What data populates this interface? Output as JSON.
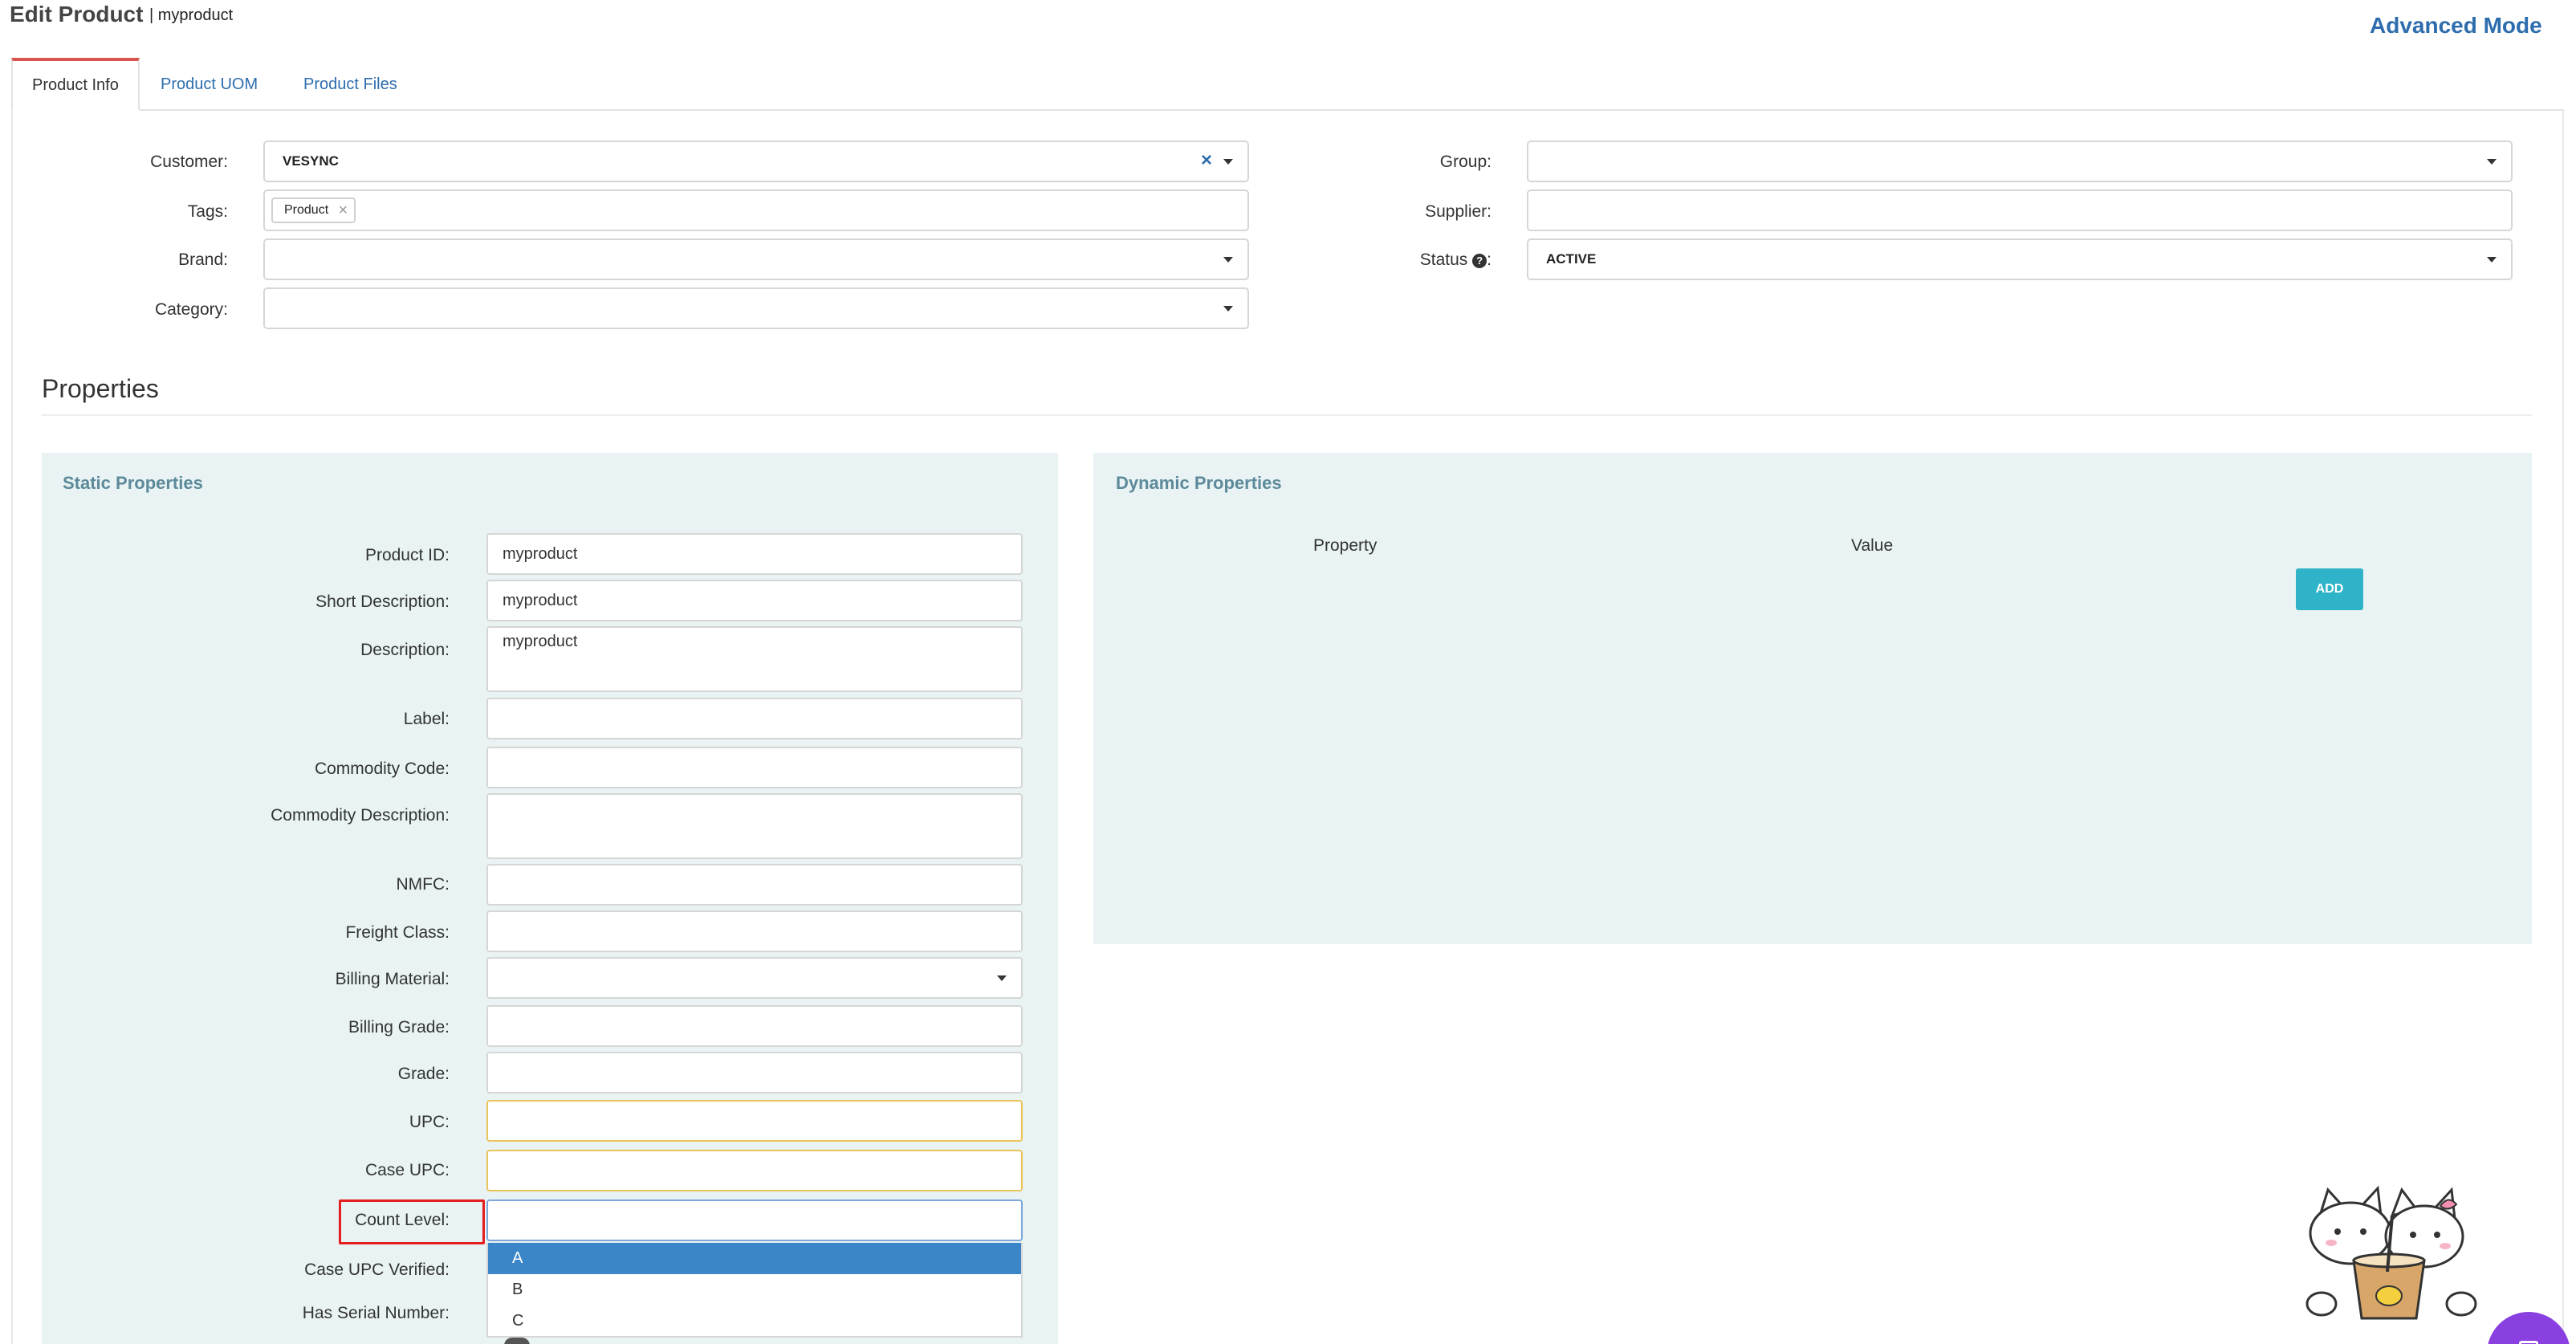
{
  "header": {
    "title": "Edit Product",
    "subtitle": "| myproduct",
    "advanced_mode": "Advanced Mode"
  },
  "tabs": [
    {
      "label": "Product Info",
      "active": true
    },
    {
      "label": "Product UOM",
      "active": false
    },
    {
      "label": "Product Files",
      "active": false
    }
  ],
  "top_form": {
    "customer": {
      "label": "Customer:",
      "value": "VESYNC"
    },
    "tags": {
      "label": "Tags:",
      "items": [
        "Product"
      ]
    },
    "brand": {
      "label": "Brand:",
      "value": ""
    },
    "category": {
      "label": "Category:",
      "value": ""
    },
    "group": {
      "label": "Group:",
      "value": ""
    },
    "supplier": {
      "label": "Supplier:",
      "value": ""
    },
    "status": {
      "label": "Status",
      "suffix": ":",
      "value": "ACTIVE"
    }
  },
  "properties": {
    "title": "Properties",
    "static_title": "Static Properties",
    "dynamic_title": "Dynamic Properties",
    "dynamic_columns": [
      "Property",
      "Value"
    ],
    "add_label": "ADD"
  },
  "static_fields": [
    {
      "label": "Product ID:",
      "value": "myproduct"
    },
    {
      "label": "Short Description:",
      "value": "myproduct"
    },
    {
      "label": "Description:",
      "value": "myproduct"
    },
    {
      "label": "Label:",
      "value": ""
    },
    {
      "label": "Commodity Code:",
      "value": ""
    },
    {
      "label": "Commodity Description:",
      "value": ""
    },
    {
      "label": "NMFC:",
      "value": ""
    },
    {
      "label": "Freight Class:",
      "value": ""
    },
    {
      "label": "Billing Material:",
      "value": ""
    },
    {
      "label": "Billing Grade:",
      "value": ""
    },
    {
      "label": "Grade:",
      "value": ""
    },
    {
      "label": "UPC:",
      "value": ""
    },
    {
      "label": "Case UPC:",
      "value": ""
    },
    {
      "label": "Count Level:",
      "value": ""
    },
    {
      "label": "Case UPC Verified:",
      "value": ""
    },
    {
      "label": "Has Serial Number:",
      "value": ""
    }
  ],
  "count_level_options": [
    "A",
    "B",
    "C"
  ],
  "colors": {
    "accent": "#2d6dad",
    "panel_bg": "#e9f3f3",
    "add_button": "#2fb3c8",
    "option_highlight": "#3a86c8",
    "highlight_box": "#e41e1e"
  }
}
